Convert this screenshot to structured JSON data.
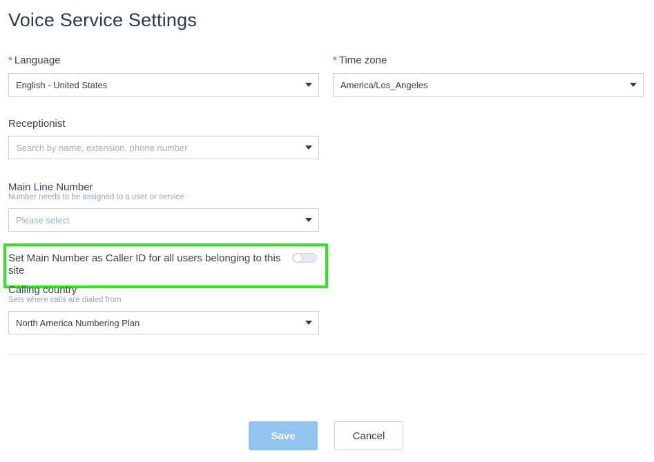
{
  "page": {
    "title": "Voice Service Settings"
  },
  "language": {
    "required_mark": "*",
    "label": "Language",
    "value": "English - United States"
  },
  "timezone": {
    "required_mark": "*",
    "label": "Time zone",
    "value": "America/Los_Angeles"
  },
  "receptionist": {
    "label": "Receptionist",
    "placeholder": "Search by name, extension, phone number"
  },
  "main_line": {
    "label": "Main Line Number",
    "hint": "Number needs to be assigned to a user or service",
    "placeholder": "Please select"
  },
  "caller_id": {
    "label": "Set Main Number as Caller ID for all users belonging to this site",
    "enabled": false
  },
  "calling_country": {
    "label": "Calling country",
    "hint": "Sets where calls are dialed from",
    "value": "North America Numbering Plan"
  },
  "actions": {
    "save_label": "Save",
    "cancel_label": "Cancel"
  },
  "colors": {
    "highlight": "#2ee61c",
    "save_button": "#90c4ef",
    "required": "#e0453a"
  }
}
